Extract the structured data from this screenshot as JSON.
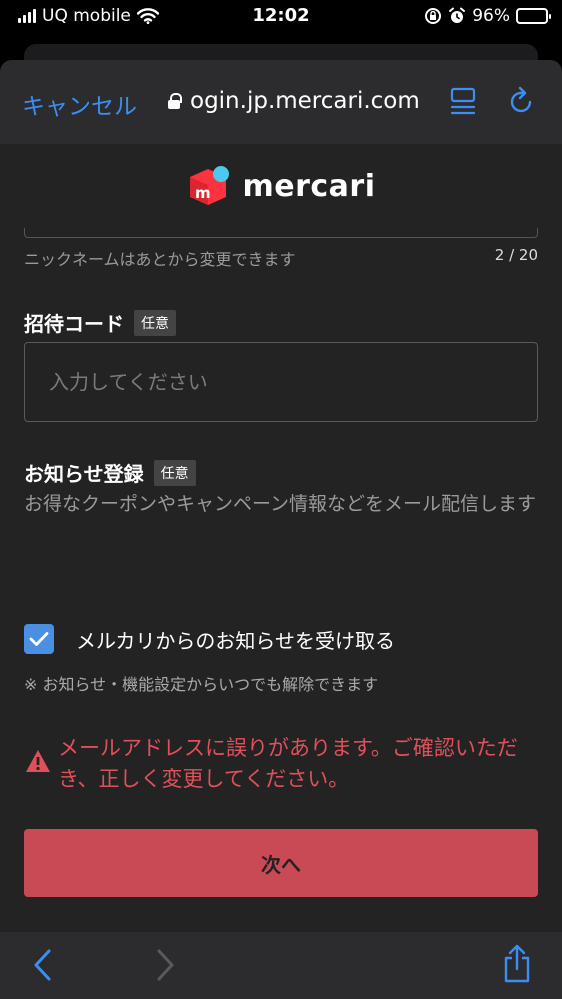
{
  "status_bar": {
    "carrier": "UQ mobile",
    "time": "12:02",
    "battery": "96%",
    "battery_level": 0.96
  },
  "browser": {
    "cancel_label": "キャンセル",
    "url": "ogin.jp.mercari.com"
  },
  "logo": {
    "text": "mercari",
    "box_color": "#ff333f",
    "dot_color": "#4dc9f0",
    "letter": "m"
  },
  "nickname": {
    "hint": "ニックネームはあとから変更できます",
    "counter": "2 / 20"
  },
  "invite": {
    "label": "招待コード",
    "badge": "任意",
    "placeholder": "入力してください",
    "value": ""
  },
  "newsletter": {
    "label": "お知らせ登録",
    "badge": "任意",
    "description": "お得なクーポンやキャンペーン情報などをメール配信します",
    "checkbox_label": "メルカリからのお知らせを受け取る",
    "checked": true,
    "note": "※ お知らせ・機能設定からいつでも解除できます"
  },
  "error": {
    "message": "メールアドレスに誤りがあります。ご確認いただき、正しく変更してください。"
  },
  "next_button": {
    "label": "次へ"
  },
  "colors": {
    "accent_blue": "#3b8ef3",
    "error_red": "#e0505a",
    "button_red": "#c94954"
  }
}
